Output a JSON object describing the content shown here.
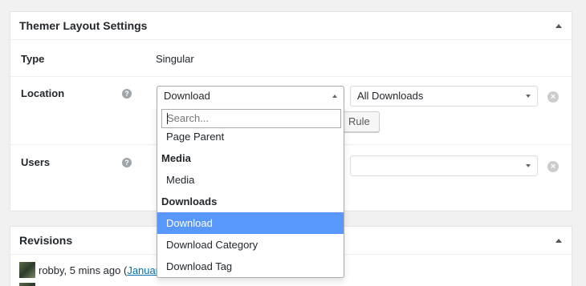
{
  "layout_panel": {
    "title": "Themer Layout Settings",
    "type": {
      "label": "Type",
      "value": "Singular"
    },
    "location": {
      "label": "Location",
      "help": "?",
      "select1_value": "Download",
      "select2_value": "All Downloads",
      "add_rule_label": "Rule",
      "remove": "×"
    },
    "users": {
      "label": "Users",
      "help": "?",
      "remove": "×"
    }
  },
  "dropdown": {
    "search_placeholder": "Search...",
    "items": [
      {
        "kind": "option",
        "label": "Page Parent"
      },
      {
        "kind": "group",
        "label": "Media"
      },
      {
        "kind": "option",
        "label": "Media"
      },
      {
        "kind": "group",
        "label": "Downloads"
      },
      {
        "kind": "option",
        "label": "Download",
        "selected": true
      },
      {
        "kind": "option",
        "label": "Download Category"
      },
      {
        "kind": "option",
        "label": "Download Tag"
      }
    ]
  },
  "revisions_panel": {
    "title": "Revisions",
    "entries": [
      {
        "author": "robby, 5 mins ago (",
        "link": "January"
      }
    ]
  },
  "colors": {
    "highlight": "#5897fb",
    "link": "#0073aa",
    "background": "#f1f1f1"
  }
}
